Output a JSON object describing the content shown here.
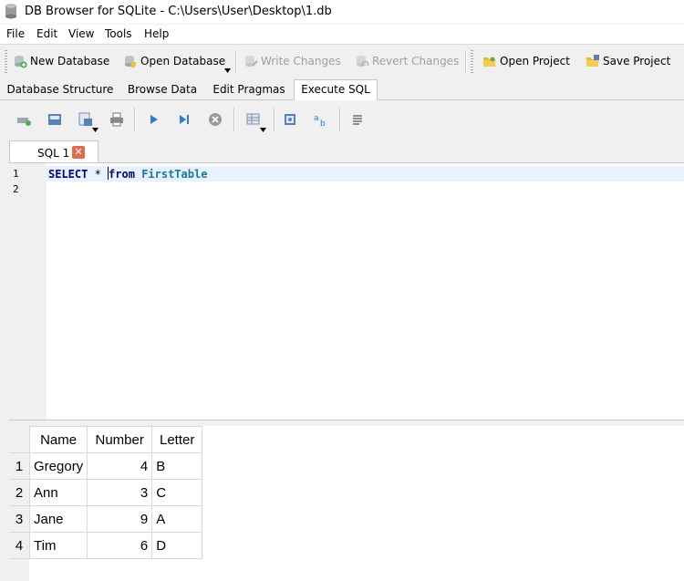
{
  "window": {
    "title": "DB Browser for SQLite - C:\\Users\\User\\Desktop\\1.db"
  },
  "menu": [
    "File",
    "Edit",
    "View",
    "Tools",
    "Help"
  ],
  "toolbar": {
    "new_database": "New Database",
    "open_database": "Open Database",
    "write_changes": "Write Changes",
    "revert_changes": "Revert Changes",
    "open_project": "Open Project",
    "save_project": "Save Project"
  },
  "tabs": [
    "Database Structure",
    "Browse Data",
    "Edit Pragmas",
    "Execute SQL"
  ],
  "active_tab": "Execute SQL",
  "sql_tab": {
    "label": "SQL 1"
  },
  "editor": {
    "line_numbers": [
      "1",
      "2"
    ],
    "keyword_select": "SELECT",
    "star": " * ",
    "keyword_from": "from",
    "table": "FirstTable"
  },
  "results": {
    "columns": [
      "Name",
      "Number",
      "Letter"
    ],
    "rows": [
      {
        "index": "1",
        "name": "Gregory",
        "number": "4",
        "letter": "B"
      },
      {
        "index": "2",
        "name": "Ann",
        "number": "3",
        "letter": "C"
      },
      {
        "index": "3",
        "name": "Jane",
        "number": "9",
        "letter": "A"
      },
      {
        "index": "4",
        "name": "Tim",
        "number": "6",
        "letter": "D"
      }
    ]
  },
  "colors": {
    "current_line": "#e8f2fe",
    "sql_keyword": "#00007f",
    "sql_table": "#157a9a",
    "close_tab": "#e26a50"
  }
}
